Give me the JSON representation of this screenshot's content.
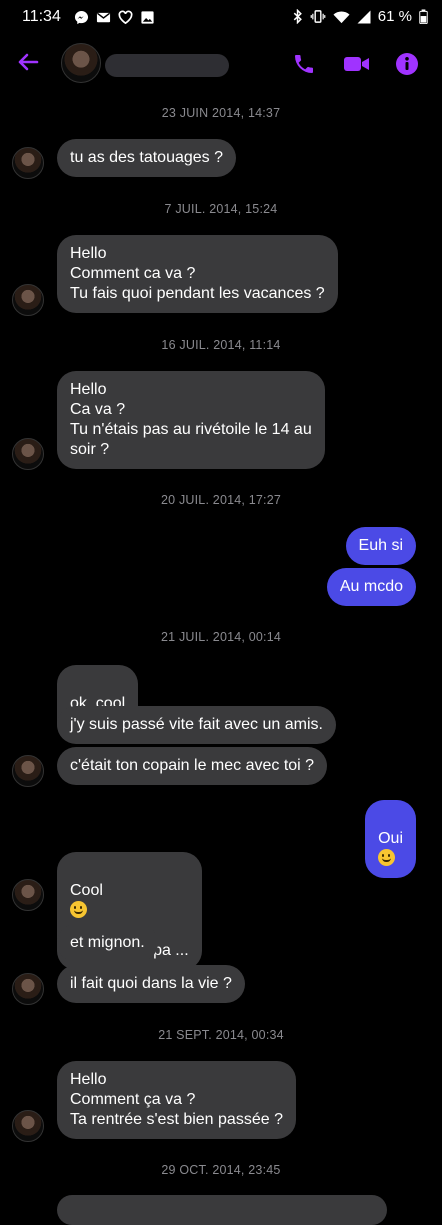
{
  "status_bar": {
    "time": "11:34",
    "battery": "61 %"
  },
  "header": {
    "contact_name": ""
  },
  "messages": [
    {
      "type": "timestamp",
      "text": "23 JUIN 2014, 14:37"
    },
    {
      "type": "incoming",
      "text": "tu as des tatouages ?"
    },
    {
      "type": "timestamp",
      "text": "7 JUIL. 2014, 15:24"
    },
    {
      "type": "incoming",
      "text": "Hello\nComment ca va ?\nTu fais quoi pendant les vacances ?"
    },
    {
      "type": "timestamp",
      "text": "16 JUIL. 2014, 11:14"
    },
    {
      "type": "incoming",
      "text": "Hello\nCa va ?\nTu n'étais pas au rivétoile le 14 au\nsoir ?"
    },
    {
      "type": "timestamp",
      "text": "20 JUIL. 2014, 17:27"
    },
    {
      "type": "outgoing",
      "text": "Euh si"
    },
    {
      "type": "outgoing",
      "text": "Au mcdo"
    },
    {
      "type": "timestamp",
      "text": "21 JUIL. 2014, 00:14"
    },
    {
      "type": "incoming",
      "text": "ok, cool",
      "emoji": "slightly-smiling-face"
    },
    {
      "type": "incoming",
      "text": "j'y suis passé vite fait avec un amis."
    },
    {
      "type": "incoming",
      "text": "c'était ton copain le mec avec toi ?"
    },
    {
      "type": "outgoing",
      "text": "Oui",
      "emoji": "slightly-smiling-face"
    },
    {
      "type": "incoming",
      "text_line1": "Cool",
      "text_line2": "il a l'air sympa ...",
      "emoji": "slightly-smiling-face"
    },
    {
      "type": "incoming",
      "text": "et mignon."
    },
    {
      "type": "incoming",
      "text": "il fait quoi dans la vie ?"
    },
    {
      "type": "timestamp",
      "text": "21 SEPT. 2014, 00:34"
    },
    {
      "type": "incoming",
      "text": "Hello\nComment ça va ?\nTa rentrée s'est bien passée ?"
    },
    {
      "type": "timestamp",
      "text": "29 OCT. 2014, 23:45"
    }
  ],
  "icons": {
    "back": "arrow-left-icon",
    "call": "phone-icon",
    "video": "video-camera-icon",
    "info": "info-icon"
  },
  "colors": {
    "accent": "#a033ff",
    "outgoing_bubble": "#4b4ae6",
    "incoming_bubble": "#3a3a3c",
    "background": "#000000",
    "timestamp": "#8a8a8f"
  }
}
